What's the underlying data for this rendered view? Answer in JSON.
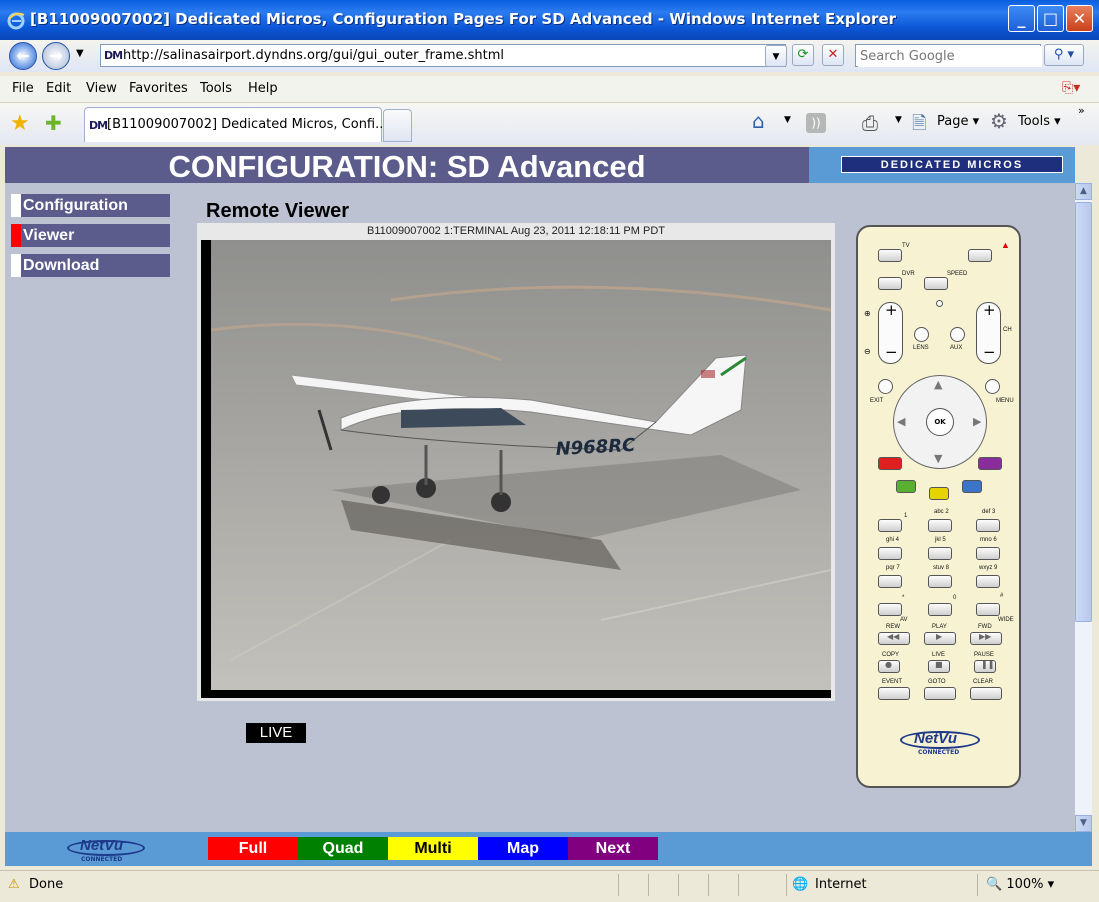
{
  "window": {
    "title": "[B11009007002] Dedicated Micros, Configuration Pages For SD Advanced - Windows Internet Explorer",
    "minimize": "_",
    "maximize": "□",
    "close": "✕"
  },
  "address_bar": {
    "url": "http://salinasairport.dyndns.org/gui/gui_outer_frame.shtml",
    "search_placeholder": "Search Google",
    "site_icon": "DM"
  },
  "menu": [
    "File",
    "Edit",
    "View",
    "Favorites",
    "Tools",
    "Help"
  ],
  "tab": {
    "title": "[B11009007002] Dedicated Micros, Confi..."
  },
  "command_bar": {
    "page": "Page",
    "tools": "Tools"
  },
  "page": {
    "header_title": "CONFIGURATION: SD Advanced",
    "brand_logo": "DEDICATED MICROS",
    "nav": [
      {
        "label": "Configuration",
        "active": false
      },
      {
        "label": "Viewer",
        "active": true
      },
      {
        "label": "Download",
        "active": false
      }
    ],
    "viewer_title": "Remote Viewer",
    "camera_timestamp": "B11009007002 1:TERMINAL Aug 23, 2011 12:18:11 PM PDT",
    "plane_registration": "N968RC",
    "live_label": "LIVE"
  },
  "remote": {
    "labels": {
      "tv": "TV",
      "dvr": "DVR",
      "speed": "SPEED",
      "lens": "LENS",
      "aux": "AUX",
      "ch": "CH",
      "exit": "EXIT",
      "menu": "MENU",
      "ok": "OK",
      "k1": "1",
      "k2": "abc 2",
      "k3": "def 3",
      "k4": "ghi 4",
      "k5": "jkl 5",
      "k6": "mno 6",
      "k7": "pqr 7",
      "k8": "stuv 8",
      "k9": "wxyz 9",
      "star": "*",
      "k0": "0",
      "hash": "#",
      "av": "AV",
      "wide": "WIDE",
      "rew": "REW",
      "play": "PLAY",
      "fwd": "FWD",
      "copy": "COPY",
      "live": "LIVE",
      "pause": "PAUSE",
      "event": "EVENT",
      "goto": "GOTO",
      "clear": "CLEAR",
      "plus": "+",
      "minus": "−"
    },
    "logo": "NetVu",
    "logo_sub": "CONNECTED"
  },
  "bottom_bar": {
    "logo": "NetVu",
    "logo_sub": "CONNECTED",
    "buttons": [
      {
        "label": "Full",
        "bg": "#ff0000",
        "fg": "#ffffff"
      },
      {
        "label": "Quad",
        "bg": "#008000",
        "fg": "#ffffff"
      },
      {
        "label": "Multi",
        "bg": "#ffff00",
        "fg": "#000000"
      },
      {
        "label": "Map",
        "bg": "#0000ff",
        "fg": "#ffffff"
      },
      {
        "label": "Next",
        "bg": "#800080",
        "fg": "#ffffff"
      }
    ]
  },
  "status_bar": {
    "status": "Done",
    "zone": "Internet",
    "zoom": "100%"
  },
  "colors": {
    "header_bg": "#5b5b8c",
    "logo_bg": "#5b9bd5",
    "page_bg": "#bcc2d2",
    "active_marker": "#ff0000"
  }
}
